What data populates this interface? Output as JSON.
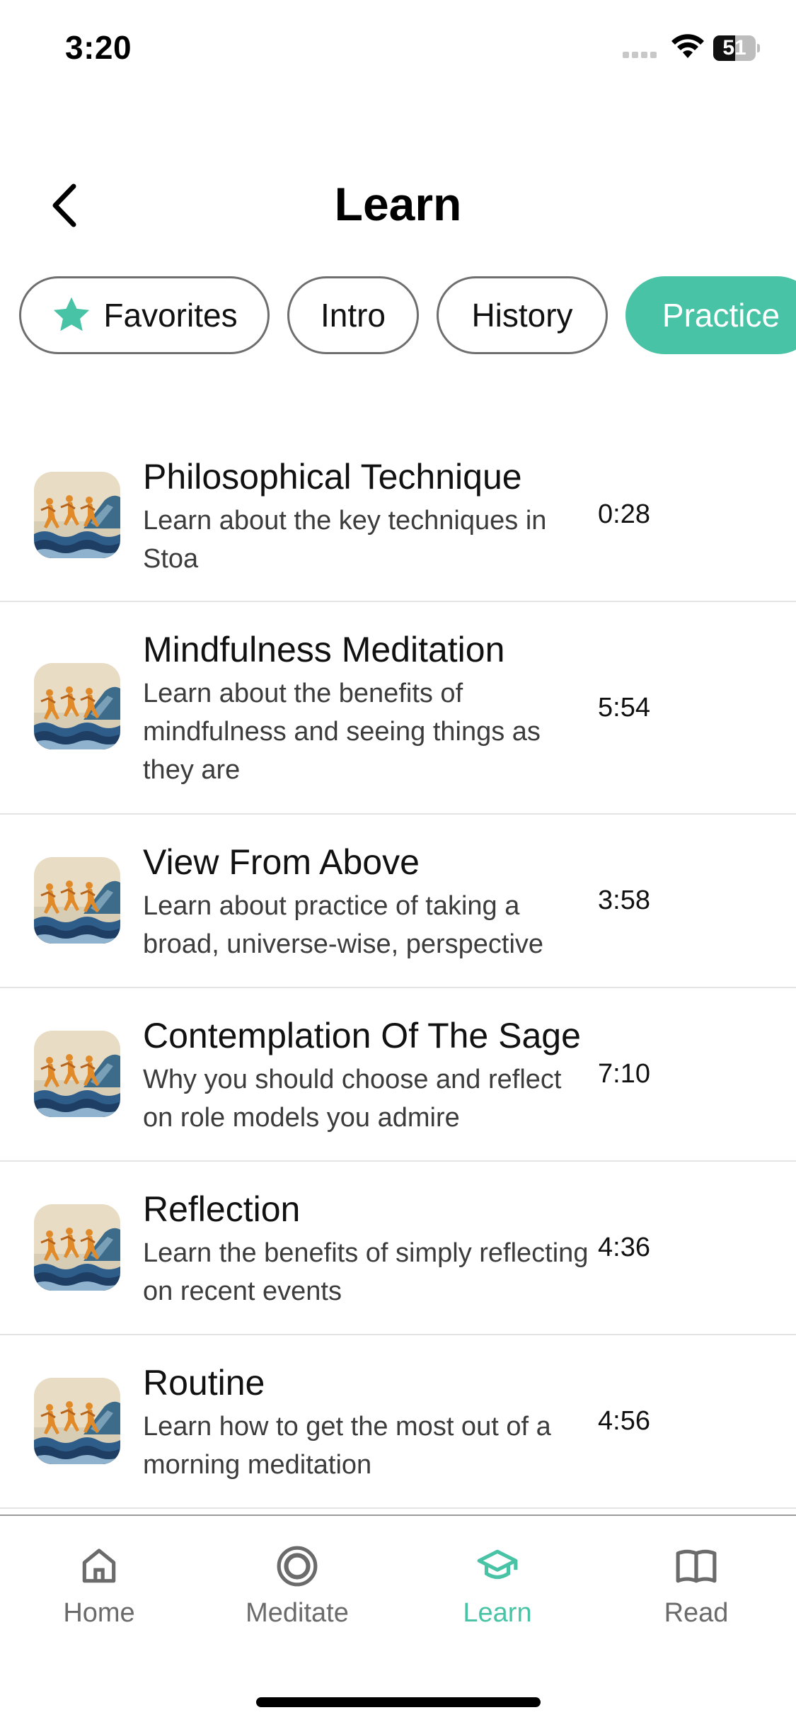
{
  "status": {
    "time": "3:20",
    "battery": "51",
    "battery_level": 0.51
  },
  "header": {
    "title": "Learn"
  },
  "chips": [
    {
      "label": "Favorites",
      "icon": "star-icon",
      "active": false
    },
    {
      "label": "Intro",
      "active": false
    },
    {
      "label": "History",
      "active": false
    },
    {
      "label": "Practice",
      "active": true
    }
  ],
  "lessons": [
    {
      "title": "Philosophical Technique",
      "description": "Learn about the key techniques in Stoa",
      "duration": "0:28"
    },
    {
      "title": "Mindfulness Meditation",
      "description": "Learn about the benefits of mindfulness and seeing things as they are",
      "duration": "5:54"
    },
    {
      "title": "View From Above",
      "description": "Learn about practice of taking a broad, universe-wise, perspective",
      "duration": "3:58"
    },
    {
      "title": "Contemplation Of The Sage",
      "description": "Why you should choose and reflect on role models you admire",
      "duration": "7:10"
    },
    {
      "title": "Reflection",
      "description": "Learn the benefits of simply reflecting on recent events",
      "duration": "4:36"
    },
    {
      "title": "Routine",
      "description": "Learn how to get the most out of a morning meditation",
      "duration": "4:56"
    }
  ],
  "tabs": [
    {
      "label": "Home",
      "icon": "home-icon",
      "active": false
    },
    {
      "label": "Meditate",
      "icon": "meditate-icon",
      "active": false
    },
    {
      "label": "Learn",
      "icon": "graduation-cap-icon",
      "active": true
    },
    {
      "label": "Read",
      "icon": "book-icon",
      "active": false
    }
  ],
  "colors": {
    "accent": "#48c3a5",
    "chip_border": "#6e6e6e",
    "divider": "#e4e4e4",
    "inactive_tab": "#6b6b6b"
  }
}
